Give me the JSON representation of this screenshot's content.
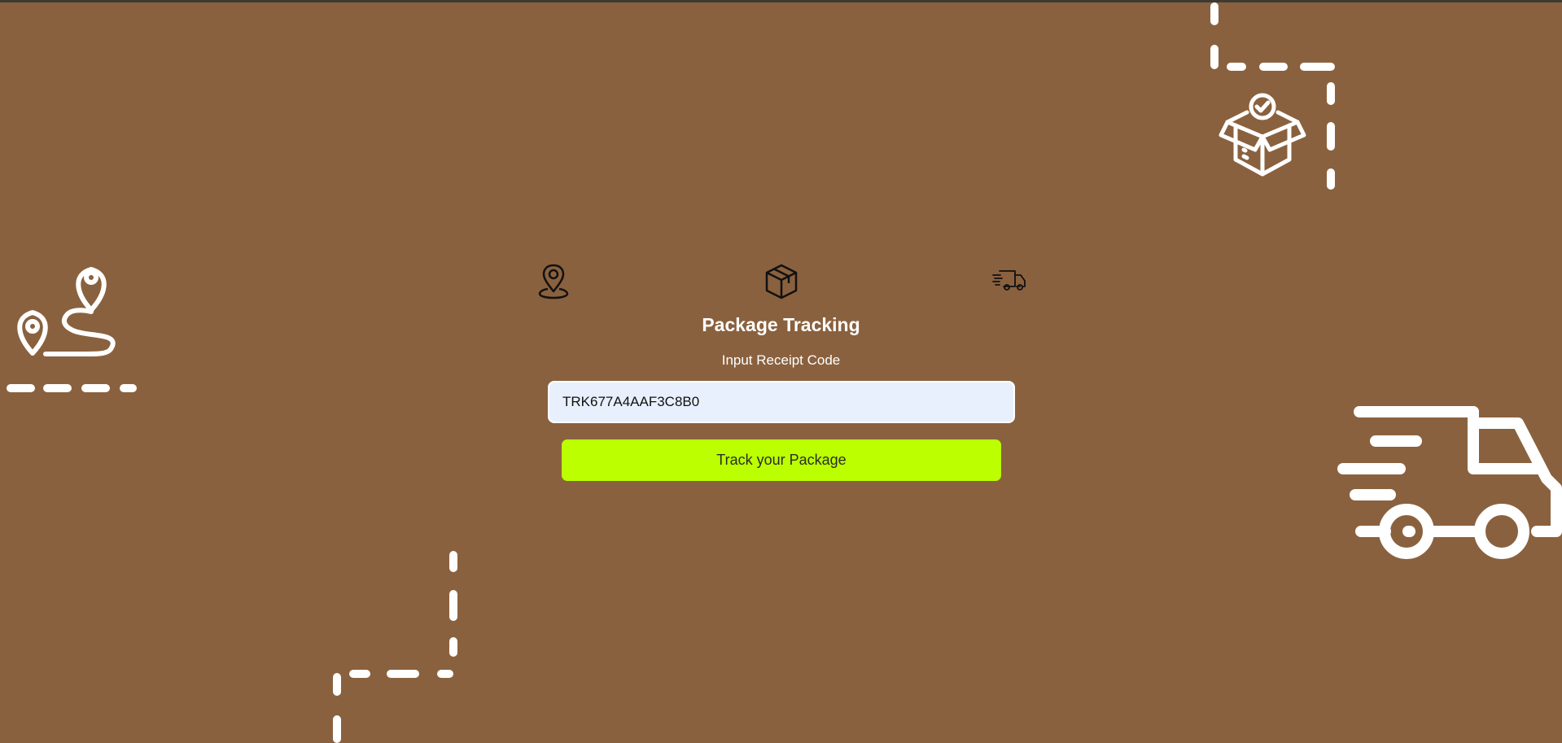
{
  "header": {
    "title": "Package Tracking",
    "subtitle": "Input Receipt Code"
  },
  "form": {
    "receipt_code_value": "TRK677A4AAF3C8B0",
    "submit_label": "Track your Package"
  },
  "icons": {
    "step_location": "map-pin-icon",
    "step_package": "package-box-icon",
    "step_delivery": "delivery-truck-icon",
    "decor_route": "route-pins-icon",
    "decor_box": "verified-box-icon",
    "decor_truck": "fast-truck-icon"
  },
  "colors": {
    "background": "#8a613e",
    "button": "#bbff00",
    "input_background": "#e8f0fe",
    "decor": "#ffffff"
  }
}
